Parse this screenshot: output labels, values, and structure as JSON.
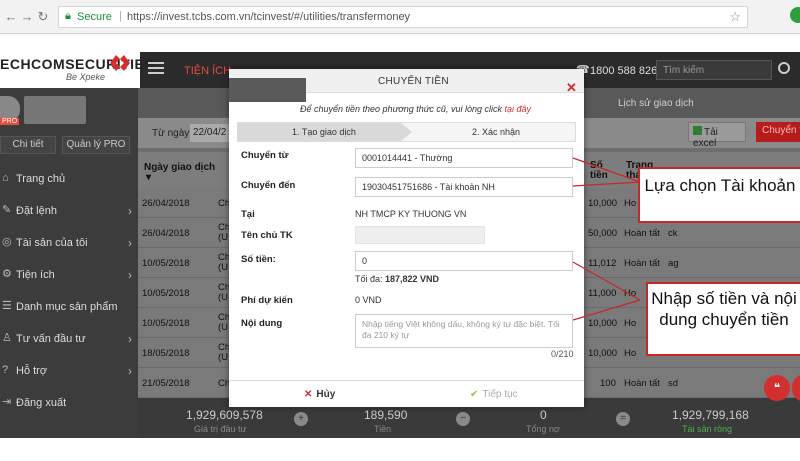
{
  "browser": {
    "secure_label": "Secure",
    "url": "https://invest.tcbs.com.vn/tcinvest/#/utilities/transfermoney",
    "back_icon": "arrow-left-icon",
    "forward_icon": "arrow-right-icon",
    "reload_icon": "reload-icon",
    "home_icon": "home-icon"
  },
  "header": {
    "logo_text": "ECHCOMSECURITIES",
    "logo_tagline": "Be Xpeke",
    "section_title": "TIỆN ÍCH",
    "hotline": "1800 588 826",
    "search_placeholder": "Tìm kiếm"
  },
  "sidebar": {
    "pro_badge": "PRO",
    "detail_button": "Chi tiết",
    "manage_pro_button": "Quản lý PRO",
    "items": [
      {
        "label": "Trang chủ",
        "icon": "home-icon",
        "chevron": false
      },
      {
        "label": "Đặt lệnh",
        "icon": "edit-icon",
        "chevron": true
      },
      {
        "label": "Tài sản của tôi",
        "icon": "coins-icon",
        "chevron": true
      },
      {
        "label": "Tiện ích",
        "icon": "gear-icon",
        "chevron": true
      },
      {
        "label": "Danh mục sản phẩm",
        "icon": "list-icon",
        "chevron": false
      },
      {
        "label": "Tư vấn đầu tư",
        "icon": "advisor-icon",
        "chevron": true
      },
      {
        "label": "Hỗ trợ",
        "icon": "help-icon",
        "chevron": true
      },
      {
        "label": "Đăng xuất",
        "icon": "logout-icon",
        "chevron": false
      }
    ]
  },
  "page": {
    "history_tab": "Lịch sử giao dịch",
    "from_date_label": "Từ ngày",
    "from_date_value": "22/04/2",
    "excel_button": "Tải excel",
    "transfer_button": "Chuyển tiền",
    "table_headers": {
      "date": "Ngày giao dịch",
      "amount": "Số tiền",
      "status": "Trạng thái"
    },
    "rows": [
      {
        "date": "26/04/2018",
        "type": "Ch",
        "amount": "10,000",
        "status": "Ho",
        "note": ""
      },
      {
        "date": "26/04/2018",
        "type": "Ch (U",
        "amount": "50,000",
        "status": "Hoàn tất",
        "note": "ck"
      },
      {
        "date": "10/05/2018",
        "type": "Ch (U",
        "amount": "11,012",
        "status": "Hoàn tất",
        "note": "ag"
      },
      {
        "date": "10/05/2018",
        "type": "Ch (U",
        "amount": "11,000",
        "status": "Ho",
        "note": ""
      },
      {
        "date": "10/05/2018",
        "type": "Ch (U",
        "amount": "10,000",
        "status": "Ho",
        "note": ""
      },
      {
        "date": "18/05/2018",
        "type": "Ch (U",
        "amount": "10,000",
        "status": "Ho",
        "note": ""
      },
      {
        "date": "21/05/2018",
        "type": "Ch",
        "amount": "100",
        "status": "Hoàn tất",
        "note": "sd"
      }
    ],
    "footer": {
      "investment_value": "1,929,609,578",
      "investment_label": "Giá trị đầu tư",
      "cash_value": "189,590",
      "cash_label": "Tiền",
      "debt_value": "0",
      "debt_label": "Tổng nợ",
      "net_value": "1,929,799,168",
      "net_label": "Tài sản ròng"
    }
  },
  "modal": {
    "title": "CHUYỂN TIỀN",
    "hint_prefix": "Để chuyển tiền theo phương thức cũ, vui lòng click ",
    "hint_link": "tại đây",
    "step1": "1. Tạo giao dịch",
    "step2": "2. Xác nhận",
    "from_label": "Chuyển từ",
    "from_value": "0001014441 - Thường",
    "to_label": "Chuyển đến",
    "to_value": "19030451751686 - Tài khoản NH",
    "bank_label": "Tại",
    "bank_value": "NH TMCP KY THUONG VN",
    "owner_label": "Tên chủ TK",
    "amount_label": "Số tiền:",
    "amount_value": "0",
    "max_label": "Tối đa: ",
    "max_value": "187,822 VND",
    "fee_label": "Phí dự kiến",
    "fee_value": "0 VND",
    "content_label": "Nội dung",
    "content_placeholder": "Nhập tiếng Việt không dấu, không ký tự đặc biệt. Tối đa 210 ký tự",
    "char_count": "0/210",
    "cancel_button": "Hủy",
    "continue_button": "Tiếp tục"
  },
  "callouts": {
    "account_select": "Lựa chọn Tài khoản",
    "amount_content": "Nhập số tiền và nội dung chuyển tiền"
  },
  "colors": {
    "brand_red": "#d32f2f",
    "callout_border": "#c62828",
    "header_dark": "#2b2b2b",
    "sidebar_dark": "#3c3c3c",
    "success_green": "#4caf50"
  }
}
